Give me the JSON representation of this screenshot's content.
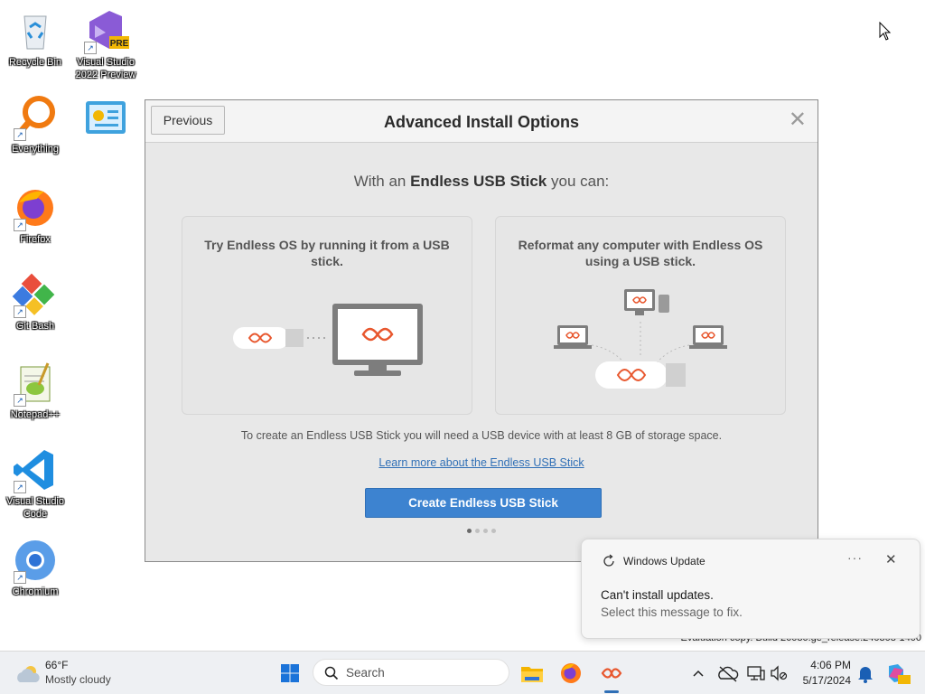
{
  "desktop": {
    "icons": [
      {
        "label": "Recycle Bin"
      },
      {
        "label": "Visual Studio 2022 Preview",
        "badge": "PRE"
      },
      {
        "label": "Everything"
      },
      {
        "label": "Firefox"
      },
      {
        "label": "Git Bash"
      },
      {
        "label": "Notepad++"
      },
      {
        "label": "Visual Studio Code"
      },
      {
        "label": "Chromium"
      }
    ]
  },
  "dialog": {
    "previous_label": "Previous",
    "title": "Advanced Install Options",
    "close_glyph": "✕",
    "subtitle_pre": "With an ",
    "subtitle_bold": "Endless USB Stick",
    "subtitle_post": " you can:",
    "card1_text": "Try Endless OS by running it from a USB stick.",
    "card2_text": "Reformat any computer with Endless OS using a USB stick.",
    "note": "To create an Endless USB Stick you will need a USB device with at least 8 GB of storage space.",
    "learn_more": "Learn more about the Endless USB Stick",
    "create_button": "Create Endless USB Stick",
    "page_dots": {
      "count": 4,
      "active": 1
    }
  },
  "notification": {
    "app": "Windows Update",
    "more": "···",
    "close": "✕",
    "title": "Can't install updates.",
    "body": "Select this message to fix."
  },
  "watermark": "Evaluation copy. Build 26080.ge_release.240308-1400",
  "taskbar": {
    "weather_temp": "66°F",
    "weather_desc": "Mostly cloudy",
    "search_placeholder": "Search",
    "time": "4:06 PM",
    "date": "5/17/2024"
  },
  "colors": {
    "accent": "#3d83d0",
    "endless_orange": "#e8572e"
  }
}
